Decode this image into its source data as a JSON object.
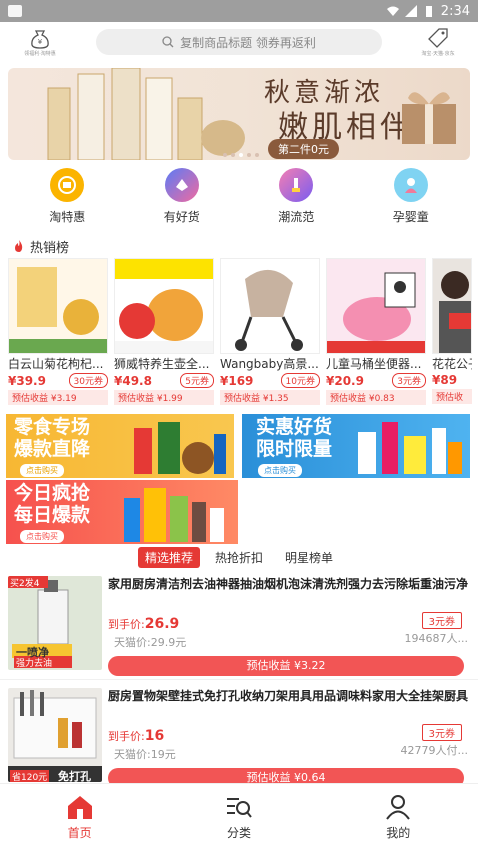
{
  "status_bar": {
    "time": "2:34"
  },
  "top_bar": {
    "left_caption": "领福利·淘特惠",
    "search_placeholder": "复制商品标题 领券再返利",
    "right_caption": "淘宝·天猫·京东"
  },
  "banner": {
    "line1": "秋意渐浓",
    "line2": "嫩肌相伴",
    "pill": "第二件0元",
    "dot_count": 5,
    "active_dot": 3
  },
  "categories": [
    {
      "label": "淘特惠",
      "icon": "coupon-icon",
      "color": "#f7b500"
    },
    {
      "label": "有好货",
      "icon": "good-goods-icon",
      "color": "#7c6cf0"
    },
    {
      "label": "潮流范",
      "icon": "brush-icon",
      "color": "#f05a8f"
    },
    {
      "label": "孕婴童",
      "icon": "mother-baby-icon",
      "color": "#f07a9a"
    }
  ],
  "hot_section": {
    "title": "热销榜"
  },
  "hot_items": [
    {
      "name": "白云山菊花枸杞...",
      "price": "¥39.9",
      "coupon": "30元券",
      "earn": "预估收益 ¥3.19"
    },
    {
      "name": "狮威特养生壶全...",
      "price": "¥49.8",
      "coupon": "5元券",
      "earn": "预估收益 ¥1.99"
    },
    {
      "name": "Wangbaby高景...",
      "price": "¥169",
      "coupon": "10元券",
      "earn": "预估收益 ¥1.35"
    },
    {
      "name": "儿童马桶坐便器...",
      "price": "¥20.9",
      "coupon": "3元券",
      "earn": "预估收益 ¥0.83"
    },
    {
      "name": "花花公子...",
      "price": "¥89",
      "coupon": "",
      "earn": "预估收"
    }
  ],
  "promos": {
    "snack": {
      "line1": "零食专场",
      "line2": "爆款直降",
      "btn": "点击购买"
    },
    "deal": {
      "line1": "实惠好货",
      "line2": "限时限量",
      "btn": "点击购买"
    },
    "flash": {
      "line1": "今日疯抢",
      "line2": "每日爆款",
      "btn": "点击购买"
    }
  },
  "tabs": [
    "精选推荐",
    "热抢折扣",
    "明星榜单"
  ],
  "products": [
    {
      "title": "家用厨房清洁剂去油神器抽油烟机泡沫清洗剂强力去污除垢重油污净",
      "now_label": "到手价:",
      "now_price": "26.9",
      "tmall": "天猫价:29.9元",
      "coupon": "3元券",
      "sold": "194687人...",
      "earn": "预估收益 ¥3.22",
      "badge": "买2发4",
      "img_text1": "一喷净",
      "img_text2": "强力去油"
    },
    {
      "title": "厨房置物架壁挂式免打孔收纳刀架用具用品调味料家用大全挂架厨具",
      "now_label": "到手价:",
      "now_price": "16",
      "tmall": "天猫价:19元",
      "coupon": "3元券",
      "sold": "42779人付...",
      "earn": "预估收益 ¥0.64",
      "badge": "省120元",
      "img_text1": "免打孔",
      "img_text2": ""
    }
  ],
  "bottom_nav": [
    {
      "label": "首页",
      "icon": "home-icon",
      "active": true
    },
    {
      "label": "分类",
      "icon": "category-search-icon",
      "active": false
    },
    {
      "label": "我的",
      "icon": "profile-icon",
      "active": false
    }
  ],
  "colors": {
    "accent": "#e53935",
    "earn_bar": "#f25555"
  }
}
